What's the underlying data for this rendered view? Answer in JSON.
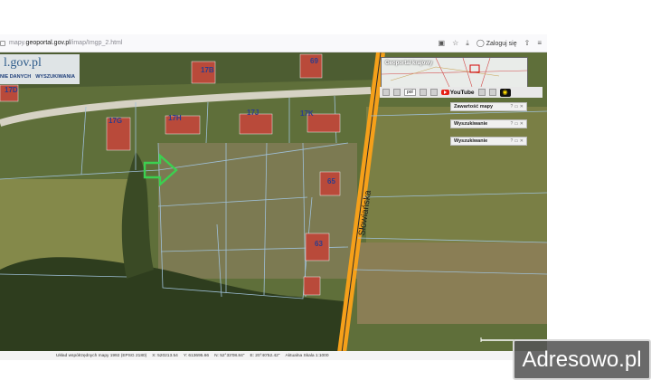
{
  "browser": {
    "url_prefix": "mapy.",
    "url_domain": "geoportal.gov.pl",
    "url_path": "/imap/Imgp_2.html",
    "login_label": "Zaloguj się"
  },
  "logo": {
    "text": "l.gov.pl",
    "menu": [
      "NIE DANYCH",
      "WYSZUKIWANIA"
    ]
  },
  "map": {
    "street_name": "Słowiańska",
    "labels": [
      "17B",
      "69",
      "17D",
      "17G",
      "17H",
      "17J",
      "17K",
      "65",
      "63"
    ],
    "colors": {
      "road": "#f5a01a",
      "parcel_lines": "#9fc0d8",
      "arrow": "#3cd050"
    }
  },
  "right_panel": {
    "minimap_title": "Geoportal krajowy",
    "select_value": "pol",
    "youtube_label": "YouTube",
    "panels": [
      "Zawartość mapy",
      "Wyszukiwanie",
      "Wyszukiwanie"
    ],
    "panel_controls": "? ▭ ✕"
  },
  "status_bar": {
    "items": [
      "Układ współrzędnych mapy 1992 (EPSG 2180)",
      "X: 520213.54",
      "Y: 613695.66",
      "N: 52°33'08.84\"",
      "E: 20°40'52.42\"",
      "Aktualna Skala 1:1000"
    ]
  },
  "watermark": {
    "text": "Adresowo.pl"
  }
}
